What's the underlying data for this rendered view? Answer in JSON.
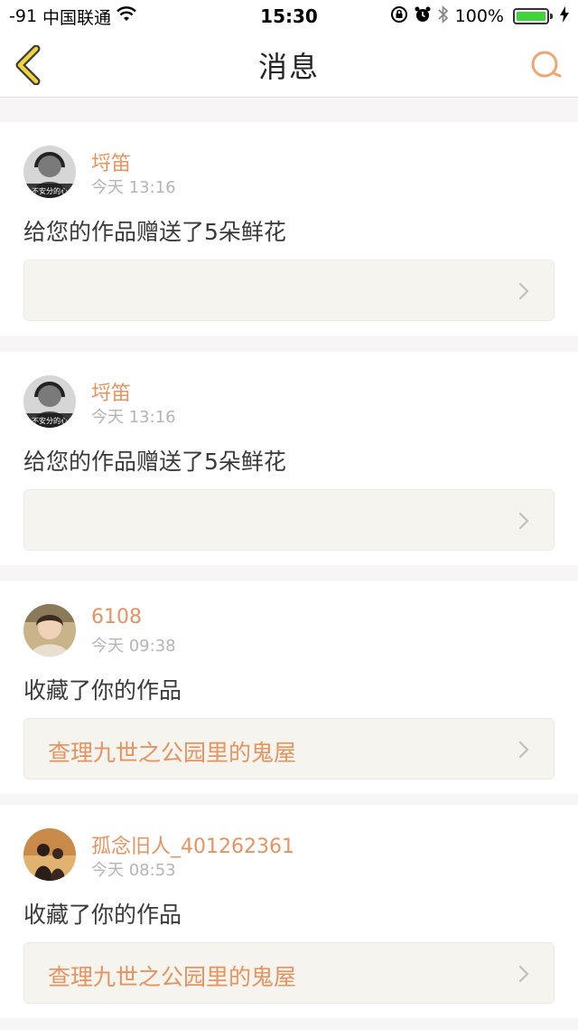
{
  "status_bar": {
    "signal": "-91",
    "carrier": "中国联通",
    "wifi_icon": "wifi-icon",
    "time": "15:30",
    "battery_percent": "100%",
    "icons": [
      "orientation-lock-icon",
      "alarm-icon",
      "bluetooth-icon",
      "battery-icon",
      "charging-icon"
    ]
  },
  "nav": {
    "title": "消息",
    "back_icon": "back-chevron-icon",
    "search_icon": "search-icon",
    "accent_color": "#e8935f"
  },
  "messages": [
    {
      "username": "埒笛",
      "time": "今天 13:16",
      "text": "给您的作品赠送了5朵鲜花",
      "link": "",
      "avatar_caption": "不安分的心"
    },
    {
      "username": "埒笛",
      "time": "今天 13:16",
      "text": "给您的作品赠送了5朵鲜花",
      "link": "",
      "avatar_caption": "不安分的心"
    },
    {
      "username": "6108",
      "time": "今天 09:38",
      "text": "收藏了你的作品",
      "link": "查理九世之公园里的鬼屋",
      "avatar_caption": ""
    },
    {
      "username": "孤念旧人_401262361",
      "time": "今天 08:53",
      "text": "收藏了你的作品",
      "link": "查理九世之公园里的鬼屋",
      "avatar_caption": ""
    }
  ]
}
